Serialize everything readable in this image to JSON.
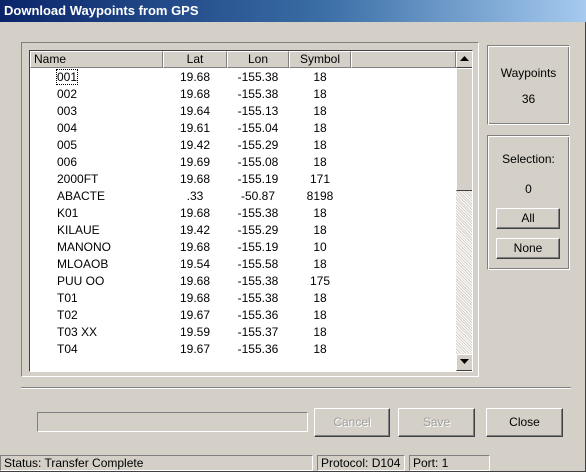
{
  "window": {
    "title": "Download Waypoints from GPS"
  },
  "list": {
    "columns": [
      "Name",
      "Lat",
      "Lon",
      "Symbol"
    ],
    "rows": [
      {
        "name": "001",
        "lat": "19.68",
        "lon": "-155.38",
        "symbol": "18"
      },
      {
        "name": "002",
        "lat": "19.68",
        "lon": "-155.38",
        "symbol": "18"
      },
      {
        "name": "003",
        "lat": "19.64",
        "lon": "-155.13",
        "symbol": "18"
      },
      {
        "name": "004",
        "lat": "19.61",
        "lon": "-155.04",
        "symbol": "18"
      },
      {
        "name": "005",
        "lat": "19.42",
        "lon": "-155.29",
        "symbol": "18"
      },
      {
        "name": "006",
        "lat": "19.69",
        "lon": "-155.08",
        "symbol": "18"
      },
      {
        "name": "2000FT",
        "lat": "19.68",
        "lon": "-155.19",
        "symbol": "171"
      },
      {
        "name": "ABACTE",
        "lat": ".33",
        "lon": "-50.87",
        "symbol": "8198"
      },
      {
        "name": "K01",
        "lat": "19.68",
        "lon": "-155.38",
        "symbol": "18"
      },
      {
        "name": "KILAUE",
        "lat": "19.42",
        "lon": "-155.29",
        "symbol": "18"
      },
      {
        "name": "MANONO",
        "lat": "19.68",
        "lon": "-155.19",
        "symbol": "10"
      },
      {
        "name": "MLOAOB",
        "lat": "19.54",
        "lon": "-155.58",
        "symbol": "18"
      },
      {
        "name": "PUU OO",
        "lat": "19.68",
        "lon": "-155.38",
        "symbol": "175"
      },
      {
        "name": "T01",
        "lat": "19.68",
        "lon": "-155.38",
        "symbol": "18"
      },
      {
        "name": "T02",
        "lat": "19.67",
        "lon": "-155.36",
        "symbol": "18"
      },
      {
        "name": "T03 XX",
        "lat": "19.59",
        "lon": "-155.37",
        "symbol": "18"
      },
      {
        "name": "T04",
        "lat": "19.67",
        "lon": "-155.36",
        "symbol": "18"
      }
    ]
  },
  "waypoints": {
    "label": "Waypoints",
    "count": "36"
  },
  "selection": {
    "label": "Selection:",
    "count": "0",
    "all_label": "All",
    "none_label": "None"
  },
  "buttons": {
    "cancel": "Cancel",
    "save": "Save",
    "close": "Close"
  },
  "status": {
    "text": "Status:  Transfer Complete",
    "protocol": "Protocol:  D104",
    "port": "Port:  1"
  }
}
